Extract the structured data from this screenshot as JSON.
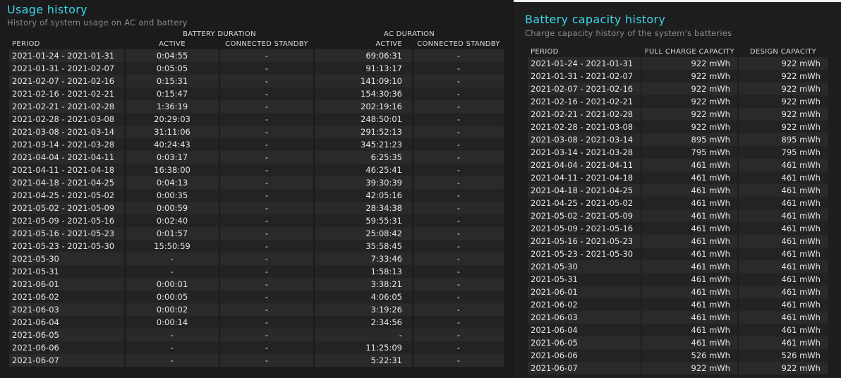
{
  "usage": {
    "title": "Usage history",
    "subtitle": "History of system usage on AC and battery",
    "group_battery": "BATTERY DURATION",
    "group_ac": "AC DURATION",
    "headers": [
      "PERIOD",
      "ACTIVE",
      "CONNECTED STANDBY",
      "ACTIVE",
      "CONNECTED STANDBY"
    ],
    "rows": [
      [
        "2021-01-24 - 2021-01-31",
        "0:04:55",
        "-",
        "69:06:31",
        "-"
      ],
      [
        "2021-01-31 - 2021-02-07",
        "0:05:05",
        "-",
        "91:13:17",
        "-"
      ],
      [
        "2021-02-07 - 2021-02-16",
        "0:15:31",
        "-",
        "141:09:10",
        "-"
      ],
      [
        "2021-02-16 - 2021-02-21",
        "0:15:47",
        "-",
        "154:30:36",
        "-"
      ],
      [
        "2021-02-21 - 2021-02-28",
        "1:36:19",
        "-",
        "202:19:16",
        "-"
      ],
      [
        "2021-02-28 - 2021-03-08",
        "20:29:03",
        "-",
        "248:50:01",
        "-"
      ],
      [
        "2021-03-08 - 2021-03-14",
        "31:11:06",
        "-",
        "291:52:13",
        "-"
      ],
      [
        "2021-03-14 - 2021-03-28",
        "40:24:43",
        "-",
        "345:21:23",
        "-"
      ],
      [
        "2021-04-04 - 2021-04-11",
        "0:03:17",
        "-",
        "6:25:35",
        "-"
      ],
      [
        "2021-04-11 - 2021-04-18",
        "16:38:00",
        "-",
        "46:25:41",
        "-"
      ],
      [
        "2021-04-18 - 2021-04-25",
        "0:04:13",
        "-",
        "39:30:39",
        "-"
      ],
      [
        "2021-04-25 - 2021-05-02",
        "0:00:35",
        "-",
        "42:05:16",
        "-"
      ],
      [
        "2021-05-02 - 2021-05-09",
        "0:00:59",
        "-",
        "28:34:38",
        "-"
      ],
      [
        "2021-05-09 - 2021-05-16",
        "0:02:40",
        "-",
        "59:55:31",
        "-"
      ],
      [
        "2021-05-16 - 2021-05-23",
        "0:01:57",
        "-",
        "25:08:42",
        "-"
      ],
      [
        "2021-05-23 - 2021-05-30",
        "15:50:59",
        "-",
        "35:58:45",
        "-"
      ],
      [
        "2021-05-30",
        "-",
        "-",
        "7:33:46",
        "-"
      ],
      [
        "2021-05-31",
        "-",
        "-",
        "1:58:13",
        "-"
      ],
      [
        "2021-06-01",
        "0:00:01",
        "-",
        "3:38:21",
        "-"
      ],
      [
        "2021-06-02",
        "0:00:05",
        "-",
        "4:06:05",
        "-"
      ],
      [
        "2021-06-03",
        "0:00:02",
        "-",
        "3:19:26",
        "-"
      ],
      [
        "2021-06-04",
        "0:00:14",
        "-",
        "2:34:56",
        "-"
      ],
      [
        "2021-06-05",
        "-",
        "-",
        "-",
        "-"
      ],
      [
        "2021-06-06",
        "-",
        "-",
        "11:25:09",
        "-"
      ],
      [
        "2021-06-07",
        "-",
        "-",
        "5:22:31",
        "-"
      ]
    ]
  },
  "capacity": {
    "title": "Battery capacity history",
    "subtitle": "Charge capacity history of the system's batteries",
    "headers": [
      "PERIOD",
      "FULL CHARGE CAPACITY",
      "DESIGN CAPACITY"
    ],
    "rows": [
      [
        "2021-01-24 - 2021-01-31",
        "922 mWh",
        "922 mWh"
      ],
      [
        "2021-01-31 - 2021-02-07",
        "922 mWh",
        "922 mWh"
      ],
      [
        "2021-02-07 - 2021-02-16",
        "922 mWh",
        "922 mWh"
      ],
      [
        "2021-02-16 - 2021-02-21",
        "922 mWh",
        "922 mWh"
      ],
      [
        "2021-02-21 - 2021-02-28",
        "922 mWh",
        "922 mWh"
      ],
      [
        "2021-02-28 - 2021-03-08",
        "922 mWh",
        "922 mWh"
      ],
      [
        "2021-03-08 - 2021-03-14",
        "895 mWh",
        "895 mWh"
      ],
      [
        "2021-03-14 - 2021-03-28",
        "795 mWh",
        "795 mWh"
      ],
      [
        "2021-04-04 - 2021-04-11",
        "461 mWh",
        "461 mWh"
      ],
      [
        "2021-04-11 - 2021-04-18",
        "461 mWh",
        "461 mWh"
      ],
      [
        "2021-04-18 - 2021-04-25",
        "461 mWh",
        "461 mWh"
      ],
      [
        "2021-04-25 - 2021-05-02",
        "461 mWh",
        "461 mWh"
      ],
      [
        "2021-05-02 - 2021-05-09",
        "461 mWh",
        "461 mWh"
      ],
      [
        "2021-05-09 - 2021-05-16",
        "461 mWh",
        "461 mWh"
      ],
      [
        "2021-05-16 - 2021-05-23",
        "461 mWh",
        "461 mWh"
      ],
      [
        "2021-05-23 - 2021-05-30",
        "461 mWh",
        "461 mWh"
      ],
      [
        "2021-05-30",
        "461 mWh",
        "461 mWh"
      ],
      [
        "2021-05-31",
        "461 mWh",
        "461 mWh"
      ],
      [
        "2021-06-01",
        "461 mWh",
        "461 mWh"
      ],
      [
        "2021-06-02",
        "461 mWh",
        "461 mWh"
      ],
      [
        "2021-06-03",
        "461 mWh",
        "461 mWh"
      ],
      [
        "2021-06-04",
        "461 mWh",
        "461 mWh"
      ],
      [
        "2021-06-05",
        "461 mWh",
        "461 mWh"
      ],
      [
        "2021-06-06",
        "526 mWh",
        "526 mWh"
      ],
      [
        "2021-06-07",
        "922 mWh",
        "922 mWh"
      ]
    ]
  },
  "colors": {
    "title_accent": "#3bd5e8",
    "background": "#1b1b1b",
    "row_odd": "#2a2a2a",
    "row_even": "#232323"
  }
}
